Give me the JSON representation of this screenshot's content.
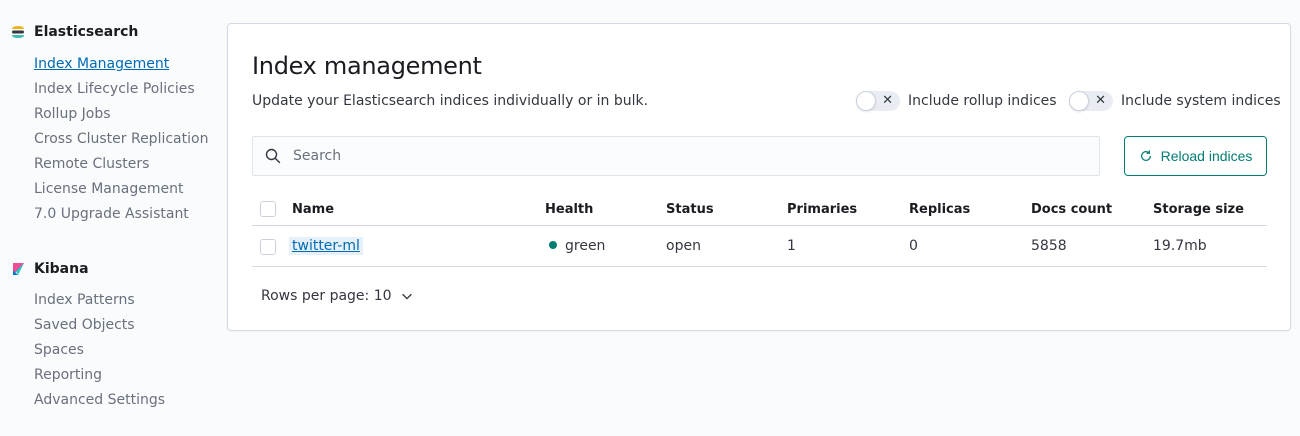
{
  "sidebar": {
    "groups": [
      {
        "title": "Elasticsearch",
        "items": [
          {
            "label": "Index Management",
            "active": true
          },
          {
            "label": "Index Lifecycle Policies"
          },
          {
            "label": "Rollup Jobs"
          },
          {
            "label": "Cross Cluster Replication"
          },
          {
            "label": "Remote Clusters"
          },
          {
            "label": "License Management"
          },
          {
            "label": "7.0 Upgrade Assistant"
          }
        ]
      },
      {
        "title": "Kibana",
        "items": [
          {
            "label": "Index Patterns"
          },
          {
            "label": "Saved Objects"
          },
          {
            "label": "Spaces"
          },
          {
            "label": "Reporting"
          },
          {
            "label": "Advanced Settings"
          }
        ]
      }
    ]
  },
  "main": {
    "title": "Index management",
    "description": "Update your Elasticsearch indices individually or in bulk.",
    "toggles": {
      "rollup": {
        "label": "Include rollup indices",
        "on": false
      },
      "system": {
        "label": "Include system indices",
        "on": false
      }
    },
    "search": {
      "placeholder": "Search",
      "value": ""
    },
    "reload_label": "Reload indices",
    "table": {
      "columns": [
        "Name",
        "Health",
        "Status",
        "Primaries",
        "Replicas",
        "Docs count",
        "Storage size"
      ],
      "rows": [
        {
          "name": "twitter-ml",
          "health": "green",
          "status": "open",
          "primaries": "1",
          "replicas": "0",
          "docs_count": "5858",
          "storage_size": "19.7mb"
        }
      ]
    },
    "pagination": {
      "label": "Rows per page: 10"
    }
  },
  "colors": {
    "accent": "#006bb4",
    "primary_button": "#017d73",
    "health_green": "#017d73"
  }
}
